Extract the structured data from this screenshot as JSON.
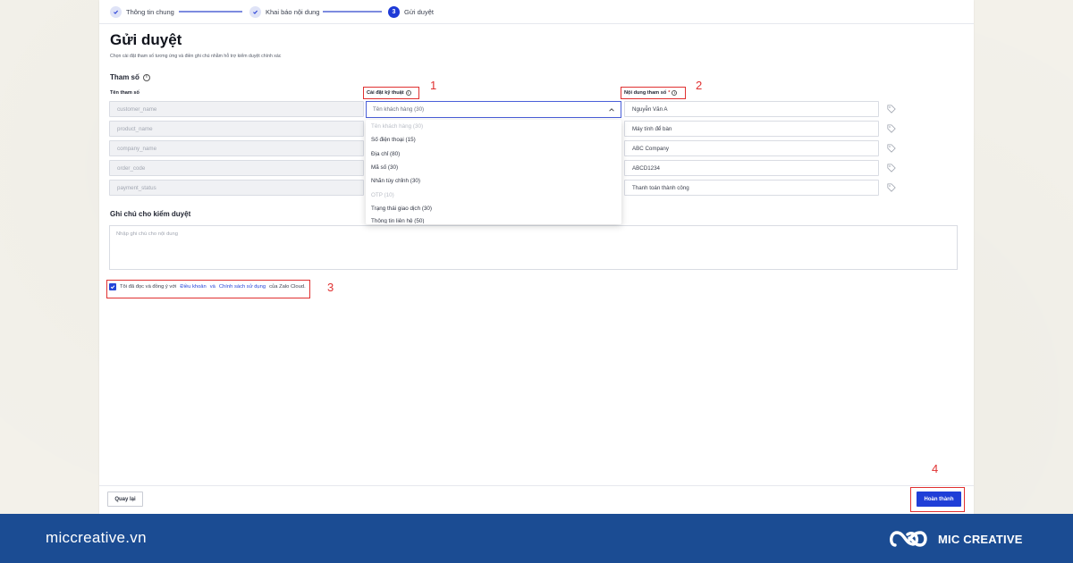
{
  "stepper": {
    "steps": [
      {
        "label": "Thông tin chung",
        "state": "done"
      },
      {
        "label": "Khai báo nội dung",
        "state": "done"
      },
      {
        "label": "Gửi duyệt",
        "number": "3",
        "state": "active"
      }
    ]
  },
  "page": {
    "title": "Gửi duyệt",
    "description": "Chọn cài đặt tham số tương ứng và điền ghi chú nhằm hỗ trợ kiểm duyệt chính xác"
  },
  "params": {
    "section_title": "Tham số",
    "col_name": "Tên tham số",
    "col_setting": "Cài đặt kỹ thuật",
    "col_value": "Nội dung tham số",
    "required_mark": "*",
    "rows": [
      {
        "name": "customer_name",
        "value": "Nguyễn Văn A"
      },
      {
        "name": "product_name",
        "value": "Máy tính để bàn"
      },
      {
        "name": "company_name",
        "value": "ABC Company"
      },
      {
        "name": "order_code",
        "value": "ABCD1234"
      },
      {
        "name": "payment_status",
        "value": "Thanh toán thành công"
      }
    ],
    "selected_setting": "Tên khách hàng (30)",
    "dropdown_options": [
      {
        "label": "Tên khách hàng (30)",
        "disabled": true
      },
      {
        "label": "Số điện thoại (15)",
        "disabled": false
      },
      {
        "label": "Địa chỉ (80)",
        "disabled": false
      },
      {
        "label": "Mã số (30)",
        "disabled": false
      },
      {
        "label": "Nhãn tùy chỉnh (30)",
        "disabled": false
      },
      {
        "label": "OTP (10)",
        "disabled": true
      },
      {
        "label": "Trạng thái giao dịch (30)",
        "disabled": false
      },
      {
        "label": "Thông tin liên hệ (50)",
        "disabled": false
      }
    ]
  },
  "note": {
    "title": "Ghi chú cho kiểm duyệt",
    "placeholder": "Nhập ghi chú cho nội dung"
  },
  "agreement": {
    "prefix": "Tôi đã đọc và đồng ý với",
    "terms": "Điều khoản",
    "and": "và",
    "policy": "Chính sách sử dụng",
    "suffix": "của Zalo Cloud."
  },
  "footer": {
    "back_label": "Quay lại",
    "done_label": "Hoàn thành"
  },
  "annotations": [
    "1",
    "2",
    "3",
    "4"
  ],
  "banner": {
    "url": "miccreative.vn",
    "brand": "MIC CREATIVE"
  },
  "colors": {
    "accent": "#1f3ed7",
    "annotation_red": "#e03131",
    "banner_bg": "#1b4c93"
  }
}
